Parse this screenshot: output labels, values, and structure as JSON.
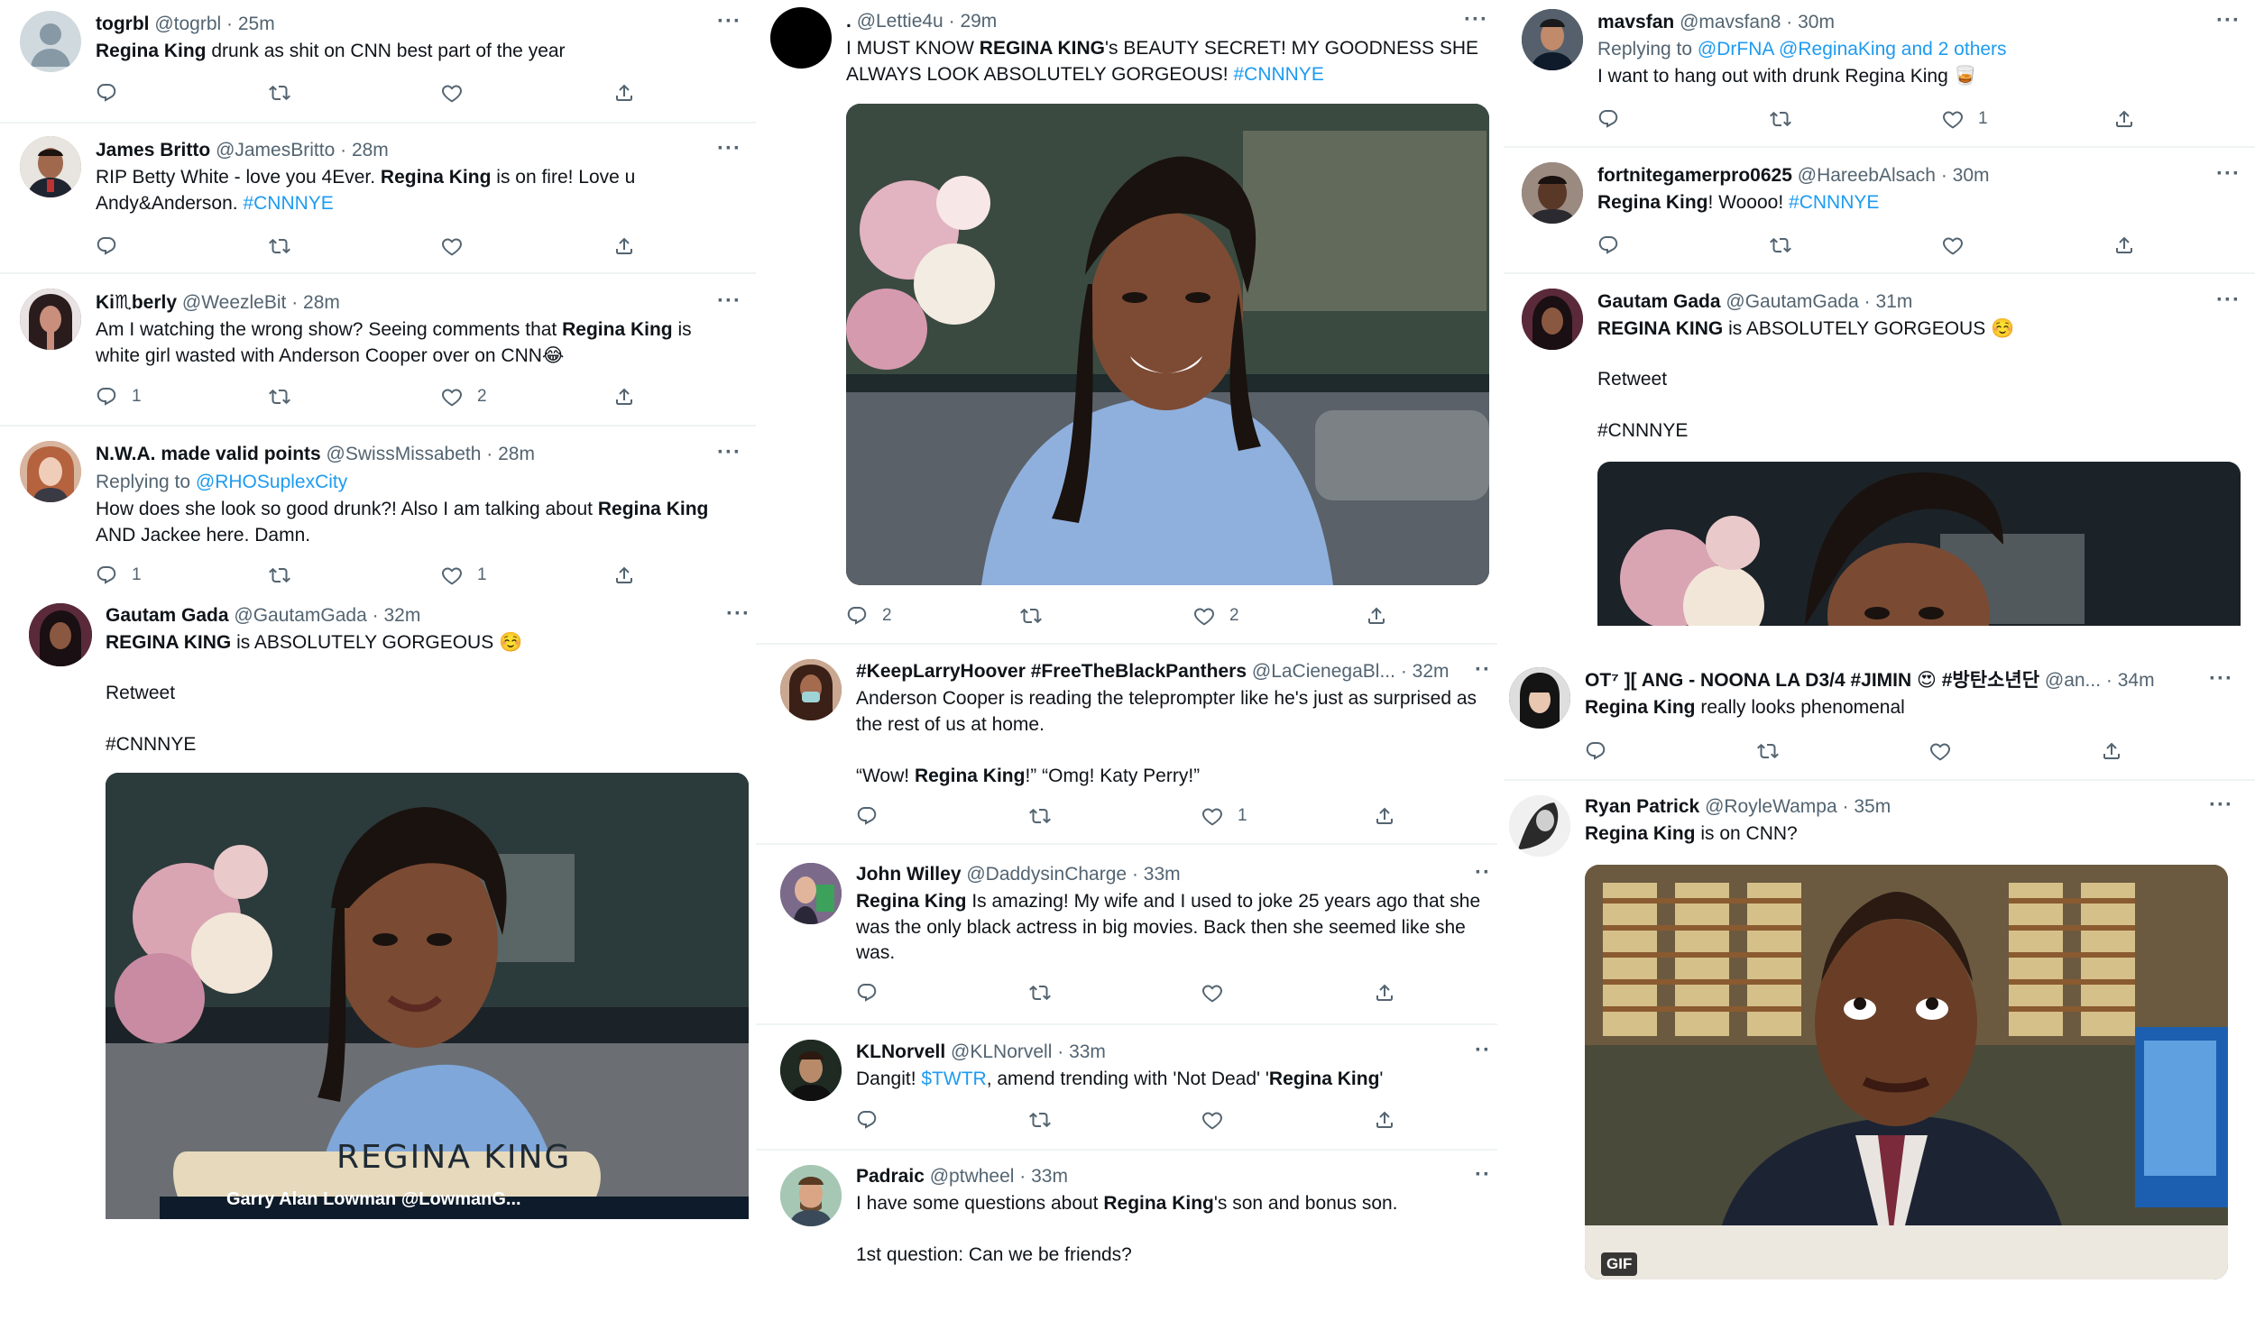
{
  "col1": {
    "t1": {
      "name": "togrbl",
      "handle": "@togrbl",
      "time": "25m",
      "more": "···",
      "text_b1": "Regina King",
      "text_1": " drunk as shit on CNN best part of the year",
      "counts": {
        "reply": "",
        "retweet": "",
        "like": ""
      }
    },
    "t2": {
      "name": "James Britto",
      "handle": "@JamesBritto",
      "time": "28m",
      "more": "···",
      "text_1": "RIP Betty White - love you 4Ever. ",
      "text_b1": "Regina King",
      "text_2": " is on fire! Love u",
      "text_3": "Andy&Anderson. ",
      "tag": "#CNNNYE"
    },
    "t3": {
      "name": "Ki♏berly",
      "handle": "@WeezleBit",
      "time": "28m",
      "more": "···",
      "text_1": "Am I watching the wrong show? Seeing comments that ",
      "text_b1": "Regina King",
      "text_2": " is",
      "text_3": "white girl wasted with Anderson Cooper over on CNN😂",
      "counts": {
        "reply": "1",
        "like": "2"
      }
    },
    "t4": {
      "name": "N.W.A. made valid points",
      "handle": "@SwissMissabeth",
      "time": "28m",
      "more": "···",
      "reply_label": "Replying to ",
      "reply_mention": "@RHOSuplexCity",
      "text_1": "How does she look so good drunk?! Also I am talking about ",
      "text_b1": "Regina King",
      "text_3": "AND Jackee here. Damn.",
      "counts": {
        "reply": "1",
        "like": "1"
      }
    },
    "t5": {
      "name": "Gautam Gada",
      "handle": "@GautamGada",
      "time": "32m",
      "more": "···",
      "text_b1": "REGINA KING",
      "text_1": " is ABSOLUTELY GORGEOUS ☺️",
      "retweet_word": "Retweet",
      "tag": "#CNNNYE",
      "caption": "REGINA KING",
      "ticker": "Garry Alan Lowman  @LowmanG..."
    }
  },
  "col2": {
    "t1": {
      "name": ".",
      "handle": "@Lettie4u",
      "time": "29m",
      "more": "···",
      "text_1": "I MUST KNOW ",
      "text_b1": "REGINA KING",
      "text_2": "'s BEAUTY SECRET! MY GOODNESS SHE",
      "text_3": "ALWAYS LOOK ABSOLUTELY GORGEOUS! ",
      "tag": "#CNNNYE",
      "counts": {
        "reply": "2",
        "like": "2"
      }
    },
    "t2": {
      "name": "#KeepLarryHoover #FreeTheBlackPanthers",
      "handle": "@LaCienegaBl...",
      "time": "32m",
      "more": "··",
      "text_1": "Anderson Cooper is reading the teleprompter like he's just as surprised as",
      "text_2": "the rest of us at home.",
      "text_3a": "“Wow! ",
      "text_b1": "Regina King",
      "text_3b": "!” “Omg! Katy Perry!”",
      "counts": {
        "like": "1"
      }
    },
    "t3": {
      "name": "John Willey",
      "handle": "@DaddysinCharge",
      "time": "33m",
      "more": "··",
      "text_b1": "Regina King",
      "text_1": " Is amazing! My wife and I used to joke 25 years ago that she",
      "text_2": "was the only black actress in big movies. Back then she seemed like she",
      "text_3": "was."
    },
    "t4": {
      "name": "KLNorvell",
      "handle": "@KLNorvell",
      "time": "33m",
      "more": "··",
      "text_1": "Dangit! ",
      "cashtag": "$TWTR",
      "text_2": ", amend trending with 'Not Dead' '",
      "text_b1": "Regina King",
      "text_3": "'"
    },
    "t5": {
      "name": "Padraic",
      "handle": "@ptwheel",
      "time": "33m",
      "more": "··",
      "text_1": "I have some questions about ",
      "text_b1": "Regina King",
      "text_2": "'s son and bonus son.",
      "text_3": "1st question: Can we be friends?"
    }
  },
  "col3": {
    "t1": {
      "name": "mavsfan",
      "handle": "@mavsfan8",
      "time": "30m",
      "more": "···",
      "reply_label": "Replying to ",
      "reply_mention": "@DrFNA @ReginaKing and 2 others",
      "text_1": "I want to hang out with drunk Regina King 🥃",
      "counts": {
        "like": "1"
      }
    },
    "t2": {
      "name": "fortnitegamerpro0625",
      "handle": "@HareebAlsach",
      "time": "30m",
      "more": "···",
      "text_b1": "Regina King",
      "text_1": "! Woooo! ",
      "tag": "#CNNNYE"
    },
    "t3": {
      "name": "Gautam Gada",
      "handle": "@GautamGada",
      "time": "31m",
      "more": "···",
      "text_b1": "REGINA KING",
      "text_1": " is ABSOLUTELY GORGEOUS ☺️",
      "retweet_word": "Retweet",
      "tag": "#CNNNYE"
    },
    "t4": {
      "name": "OT⁷ ][ ANG - NOONA LA D3/4 #JIMIN 😍 #방탄소년단",
      "handle": "@an...",
      "time": "34m",
      "more": "···",
      "text_b1": "Regina King",
      "text_1": " really looks phenomenal"
    },
    "t5": {
      "name": "Ryan Patrick",
      "handle": "@RoyleWampa",
      "time": "35m",
      "more": "···",
      "text_b1": "Regina King",
      "text_1": " is on CNN?",
      "gif": "GIF"
    }
  },
  "dot": "·",
  "colors": {
    "link": "#1d9bf0",
    "muted": "#536471",
    "text": "#0f1419",
    "border": "#eff3f4"
  },
  "icons": [
    "reply-icon",
    "retweet-icon",
    "like-icon",
    "share-icon",
    "more-icon"
  ]
}
